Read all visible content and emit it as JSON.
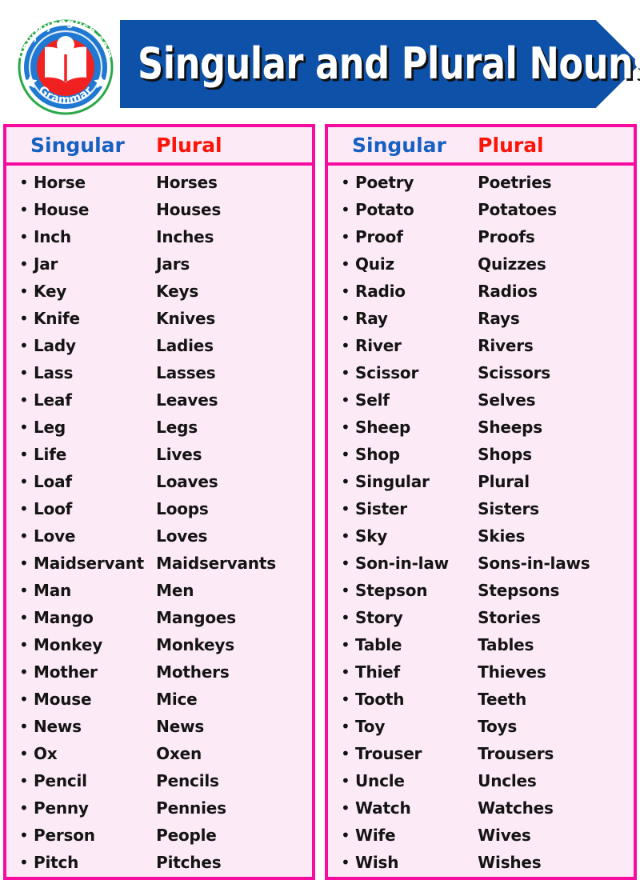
{
  "header": {
    "title": "Singular and Plural Nouns",
    "banner_color": "#0d51a8",
    "logo": {
      "top_text": "OnlyMyEnglish.com",
      "bottom_text": "Grammar",
      "icon": "open-book-reader-icon",
      "ring_color": "#1f78d1",
      "accent_color": "#2aa84a",
      "center_color": "#f12121"
    }
  },
  "theme": {
    "border_color": "#f70ca0",
    "panel_background": "#fdeaf7",
    "singular_color": "#1560c0",
    "plural_color": "#fc1408",
    "word_color": "#141414"
  },
  "columns": [
    {
      "headers": {
        "singular": "Singular",
        "plural": "Plural"
      },
      "rows": [
        {
          "singular": "Horse",
          "plural": "Horses"
        },
        {
          "singular": "House",
          "plural": "Houses"
        },
        {
          "singular": "Inch",
          "plural": "Inches"
        },
        {
          "singular": "Jar",
          "plural": "Jars"
        },
        {
          "singular": "Key",
          "plural": "Keys"
        },
        {
          "singular": "Knife",
          "plural": "Knives"
        },
        {
          "singular": "Lady",
          "plural": "Ladies"
        },
        {
          "singular": "Lass",
          "plural": "Lasses"
        },
        {
          "singular": "Leaf",
          "plural": "Leaves"
        },
        {
          "singular": "Leg",
          "plural": "Legs"
        },
        {
          "singular": "Life",
          "plural": "Lives"
        },
        {
          "singular": "Loaf",
          "plural": "Loaves"
        },
        {
          "singular": "Loof",
          "plural": "Loops"
        },
        {
          "singular": "Love",
          "plural": "Loves"
        },
        {
          "singular": "Maidservant",
          "plural": "Maidservants"
        },
        {
          "singular": "Man",
          "plural": "Men"
        },
        {
          "singular": "Mango",
          "plural": "Mangoes"
        },
        {
          "singular": "Monkey",
          "plural": "Monkeys"
        },
        {
          "singular": "Mother",
          "plural": "Mothers"
        },
        {
          "singular": "Mouse",
          "plural": "Mice"
        },
        {
          "singular": "News",
          "plural": "News"
        },
        {
          "singular": "Ox",
          "plural": "Oxen"
        },
        {
          "singular": "Pencil",
          "plural": "Pencils"
        },
        {
          "singular": "Penny",
          "plural": "Pennies"
        },
        {
          "singular": "Person",
          "plural": "People"
        },
        {
          "singular": "Pitch",
          "plural": "Pitches"
        }
      ]
    },
    {
      "headers": {
        "singular": "Singular",
        "plural": "Plural"
      },
      "rows": [
        {
          "singular": "Poetry",
          "plural": "Poetries"
        },
        {
          "singular": "Potato",
          "plural": "Potatoes"
        },
        {
          "singular": "Proof",
          "plural": "Proofs"
        },
        {
          "singular": "Quiz",
          "plural": "Quizzes"
        },
        {
          "singular": "Radio",
          "plural": "Radios"
        },
        {
          "singular": "Ray",
          "plural": "Rays"
        },
        {
          "singular": "River",
          "plural": "Rivers"
        },
        {
          "singular": "Scissor",
          "plural": "Scissors"
        },
        {
          "singular": "Self",
          "plural": "Selves"
        },
        {
          "singular": "Sheep",
          "plural": "Sheeps"
        },
        {
          "singular": "Shop",
          "plural": "Shops"
        },
        {
          "singular": "Singular",
          "plural": "Plural"
        },
        {
          "singular": "Sister",
          "plural": "Sisters"
        },
        {
          "singular": "Sky",
          "plural": "Skies"
        },
        {
          "singular": "Son-in-law",
          "plural": "Sons-in-laws"
        },
        {
          "singular": "Stepson",
          "plural": "Stepsons"
        },
        {
          "singular": "Story",
          "plural": "Stories"
        },
        {
          "singular": "Table",
          "plural": "Tables"
        },
        {
          "singular": "Thief",
          "plural": "Thieves"
        },
        {
          "singular": "Tooth",
          "plural": "Teeth"
        },
        {
          "singular": "Toy",
          "plural": "Toys"
        },
        {
          "singular": "Trouser",
          "plural": "Trousers"
        },
        {
          "singular": "Uncle",
          "plural": "Uncles"
        },
        {
          "singular": "Watch",
          "plural": "Watches"
        },
        {
          "singular": "Wife",
          "plural": "Wives"
        },
        {
          "singular": "Wish",
          "plural": "Wishes"
        }
      ]
    }
  ],
  "bullet_glyph": "•"
}
